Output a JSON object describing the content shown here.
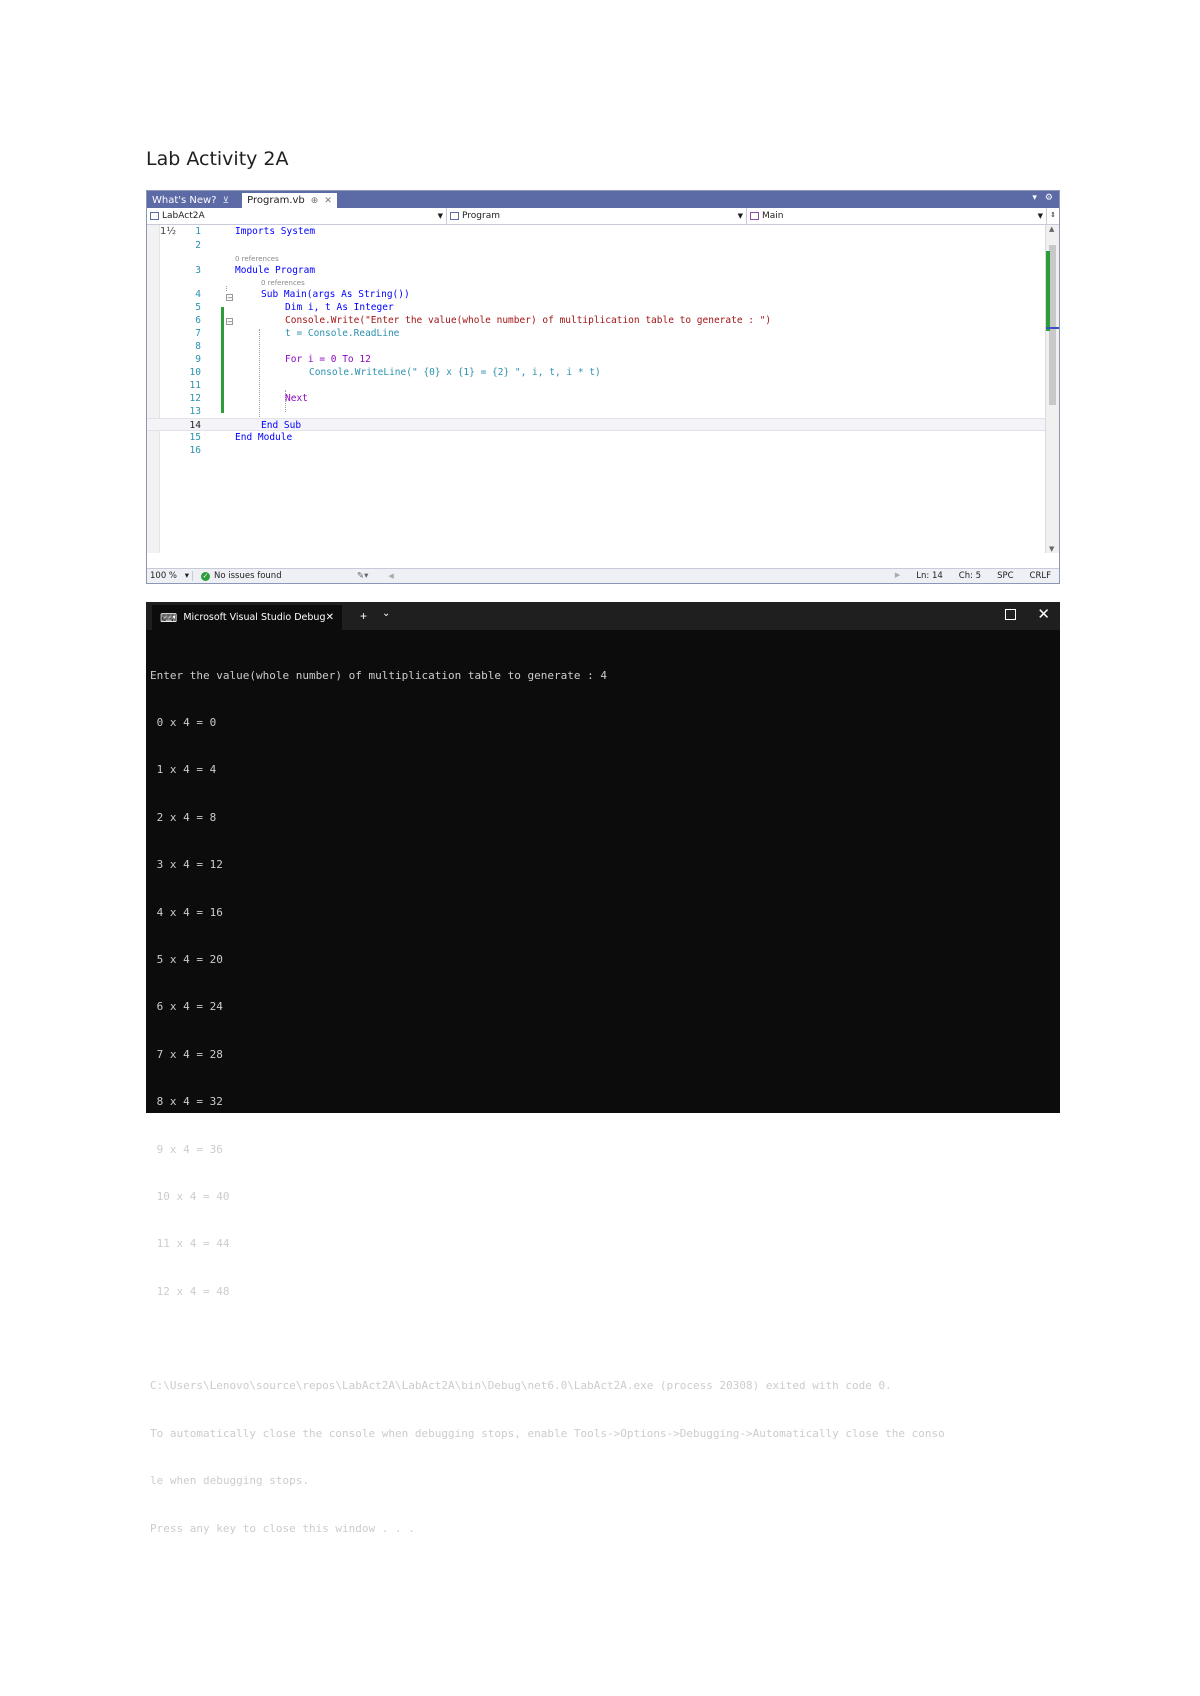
{
  "document": {
    "title": "Lab Activity 2A"
  },
  "ide": {
    "tabs": [
      {
        "label": "What's New?",
        "pin": "⊻"
      },
      {
        "label": "Program.vb",
        "pin": "⊕",
        "close": "✕"
      }
    ],
    "tab_controls": [
      "▾",
      "⚙"
    ],
    "nav": {
      "project": "LabAct2A",
      "class": "Program",
      "member": "Main"
    },
    "references_label": "0 references",
    "code_lines": [
      {
        "num": "1",
        "text": "Imports System"
      },
      {
        "num": "2",
        "text": ""
      },
      {
        "num": "3",
        "text": "Module Program"
      },
      {
        "num": "4",
        "text": "Sub Main(args As String())"
      },
      {
        "num": "5",
        "text": "Dim i, t As Integer"
      },
      {
        "num": "6",
        "text": "Console.Write(\"Enter the value(whole number) of multiplication table to generate : \")"
      },
      {
        "num": "7",
        "text": "t = Console.ReadLine"
      },
      {
        "num": "8",
        "text": ""
      },
      {
        "num": "9",
        "text": "For i = 0 To 12"
      },
      {
        "num": "10",
        "text": "Console.WriteLine(\" {0} x {1} = {2} \", i, t, i * t)"
      },
      {
        "num": "11",
        "text": ""
      },
      {
        "num": "12",
        "text": "Next"
      },
      {
        "num": "13",
        "text": ""
      },
      {
        "num": "14",
        "text": "End Sub"
      },
      {
        "num": "15",
        "text": "End Module"
      },
      {
        "num": "16",
        "text": ""
      }
    ],
    "status": {
      "zoom": "100 %",
      "issues": "No issues found",
      "position": "Ln: 14",
      "char": "Ch: 5",
      "spacing": "SPC",
      "line_ending": "CRLF"
    }
  },
  "console": {
    "tab_title": "Microsoft Visual Studio Debug",
    "output": [
      "Enter the value(whole number) of multiplication table to generate : 4",
      " 0 x 4 = 0",
      " 1 x 4 = 4",
      " 2 x 4 = 8",
      " 3 x 4 = 12",
      " 4 x 4 = 16",
      " 5 x 4 = 20",
      " 6 x 4 = 24",
      " 7 x 4 = 28",
      " 8 x 4 = 32",
      " 9 x 4 = 36",
      " 10 x 4 = 40",
      " 11 x 4 = 44",
      " 12 x 4 = 48",
      "",
      "C:\\Users\\Lenovo\\source\\repos\\LabAct2A\\LabAct2A\\bin\\Debug\\net6.0\\LabAct2A.exe (process 20308) exited with code 0.",
      "To automatically close the console when debugging stops, enable Tools->Options->Debugging->Automatically close the conso",
      "le when debugging stops.",
      "Press any key to close this window . . ."
    ]
  }
}
